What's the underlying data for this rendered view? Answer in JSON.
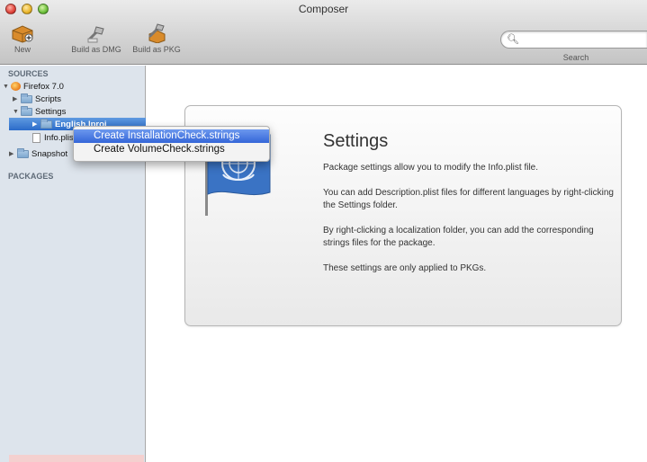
{
  "window": {
    "title": "Composer"
  },
  "toolbar": {
    "new_label": "New",
    "build_dmg_label": "Build as DMG",
    "build_pkg_label": "Build as PKG",
    "search_label": "Search",
    "search_placeholder": ""
  },
  "sidebar": {
    "sources_header": "SOURCES",
    "packages_header": "PACKAGES",
    "items": [
      {
        "label": "Firefox 7.0"
      },
      {
        "label": "Scripts"
      },
      {
        "label": "Settings"
      },
      {
        "label": "English.lproj"
      },
      {
        "label": "Info.plist"
      },
      {
        "label": "Snapshot"
      }
    ]
  },
  "context_menu": {
    "items": [
      {
        "label": "Create InstallationCheck.strings"
      },
      {
        "label": "Create VolumeCheck.strings"
      }
    ]
  },
  "content": {
    "title": "Settings",
    "paragraphs": [
      "Package settings allow you to modify the Info.plist file.",
      "You can add Description.plist files for different languages by right-clicking the Settings folder.",
      "By right-clicking a localization folder, you can add the corresponding strings files for the package.",
      "These settings are only applied to PKGs."
    ]
  },
  "colors": {
    "selection_blue": "#2b6bc9",
    "sidebar_bg": "#dde4ec",
    "flag_blue": "#3a73c4"
  }
}
